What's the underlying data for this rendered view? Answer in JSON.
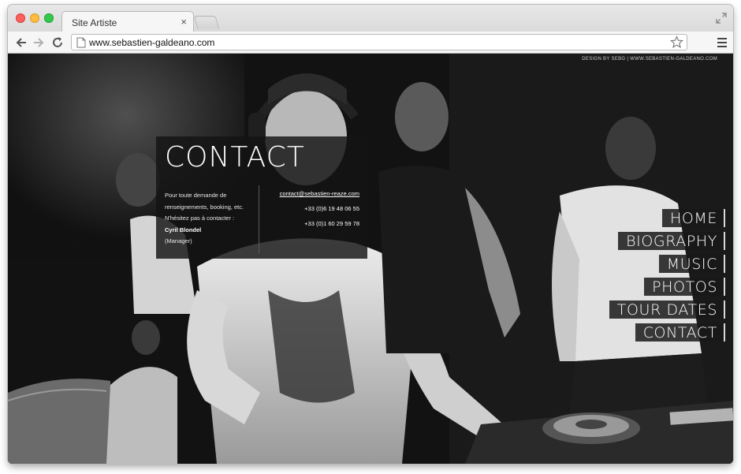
{
  "browser": {
    "tab_title": "Site Artiste",
    "tab_close": "×",
    "url": "www.sebastien-galdeano.com"
  },
  "site": {
    "credit": "DESIGN BY SEBG | WWW.SEBASTIEN-GALDEANO.COM",
    "contact": {
      "title": "CONTACT",
      "line1": "Pour toute demande de",
      "line2": "renseignements, booking, etc.",
      "line3": "N'hésitez pas à contacter :",
      "name": "Cyril Blondel",
      "role": "(Manager)",
      "email": "contact@sebastien-reaze.com",
      "phone1": "+33 (0)6 19 48 06 55",
      "phone2": "+33 (0)1 60 29 59 78"
    },
    "nav": [
      "HOME",
      "BIOGRAPHY",
      "MUSIC",
      "PHOTOS",
      "TOUR DATES",
      "CONTACT"
    ]
  }
}
